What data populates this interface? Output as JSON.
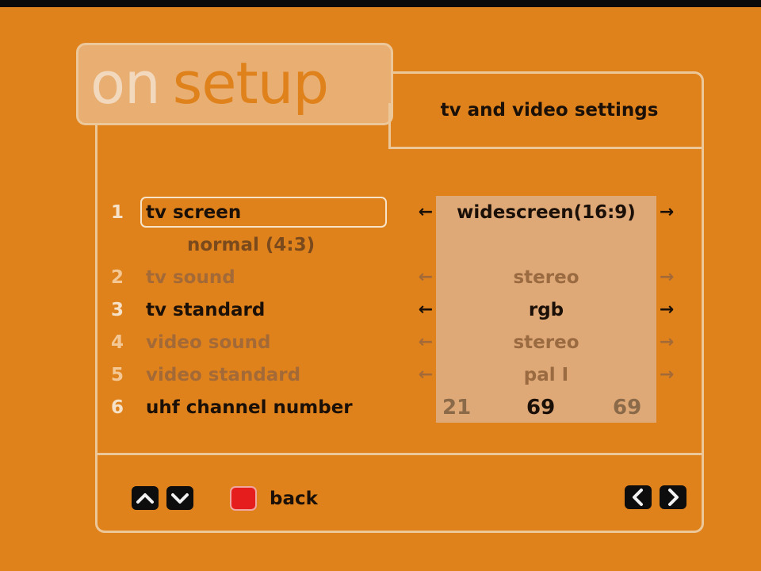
{
  "app": {
    "logo_on": "on",
    "logo_setup": "setup",
    "screen_title": "tv and video settings"
  },
  "colors": {
    "background": "#e0821c",
    "panel": "#dfa877",
    "outline": "#ecc79a",
    "back_button": "#e61d1d"
  },
  "settings": [
    {
      "number": "1",
      "label": "tv screen",
      "value": "widescreen(16:9)",
      "state": "selected",
      "arrow_left": "←",
      "arrow_right": "→",
      "option_below": "normal (4:3)"
    },
    {
      "number": "2",
      "label": "tv sound",
      "value": "stereo",
      "state": "disabled",
      "arrow_left": "←",
      "arrow_right": "→"
    },
    {
      "number": "3",
      "label": "tv standard",
      "value": "rgb",
      "state": "enabled",
      "arrow_left": "←",
      "arrow_right": "→"
    },
    {
      "number": "4",
      "label": "video sound",
      "value": "stereo",
      "state": "disabled",
      "arrow_left": "←",
      "arrow_right": "→"
    },
    {
      "number": "5",
      "label": "video standard",
      "value": "pal I",
      "state": "disabled",
      "arrow_left": "←",
      "arrow_right": "→"
    },
    {
      "number": "6",
      "label": "uhf channel number",
      "min": "21",
      "value": "69",
      "max": "69",
      "state": "enabled"
    }
  ],
  "footer": {
    "up_icon": "up-arrow-icon",
    "down_icon": "down-arrow-icon",
    "back_label": "back",
    "prev_icon": "chevron-left-icon",
    "next_icon": "chevron-right-icon"
  }
}
